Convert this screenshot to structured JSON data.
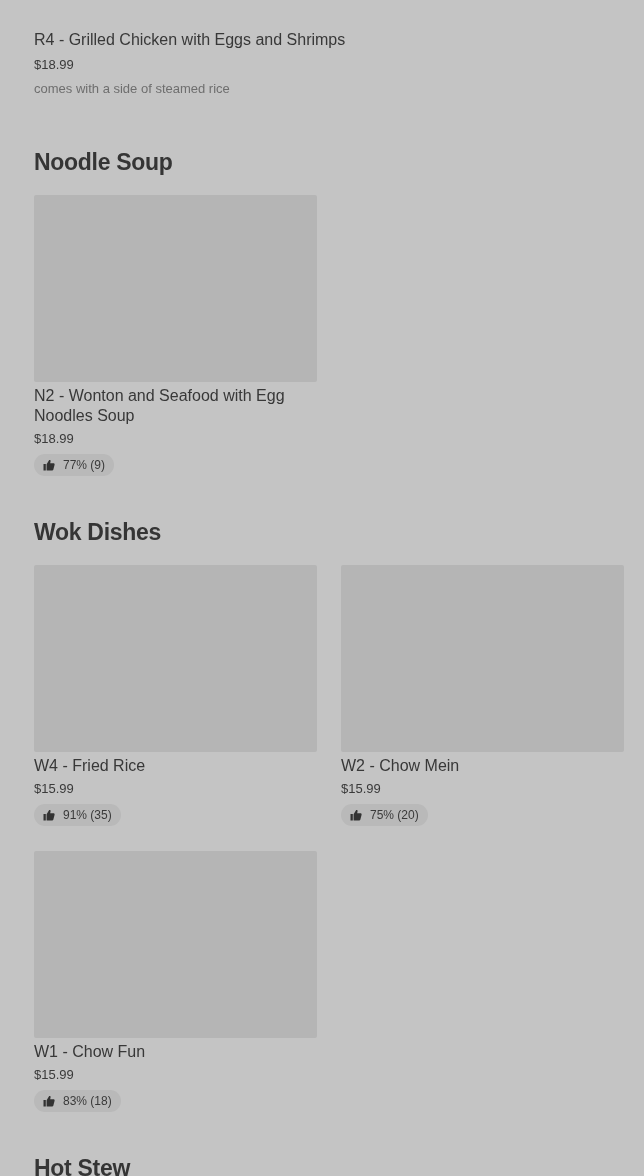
{
  "top_item": {
    "name": "R4 - Grilled Chicken with Eggs and Shrimps",
    "price": "$18.99",
    "description": "comes with a side of steamed rice"
  },
  "sections": [
    {
      "title": "Noodle Soup",
      "items": [
        {
          "name": "N2 - Wonton and Seafood with Egg Noodles Soup",
          "price": "$18.99",
          "rating": "77% (9)"
        }
      ]
    },
    {
      "title": "Wok Dishes",
      "items": [
        {
          "name": "W4 - Fried Rice",
          "price": "$15.99",
          "rating": "91% (35)"
        },
        {
          "name": "W2 - Chow Mein",
          "price": "$15.99",
          "rating": "75% (20)"
        },
        {
          "name": "W1 - Chow Fun",
          "price": "$15.99",
          "rating": "83% (18)"
        }
      ]
    },
    {
      "title": "Hot Stew"
    }
  ]
}
